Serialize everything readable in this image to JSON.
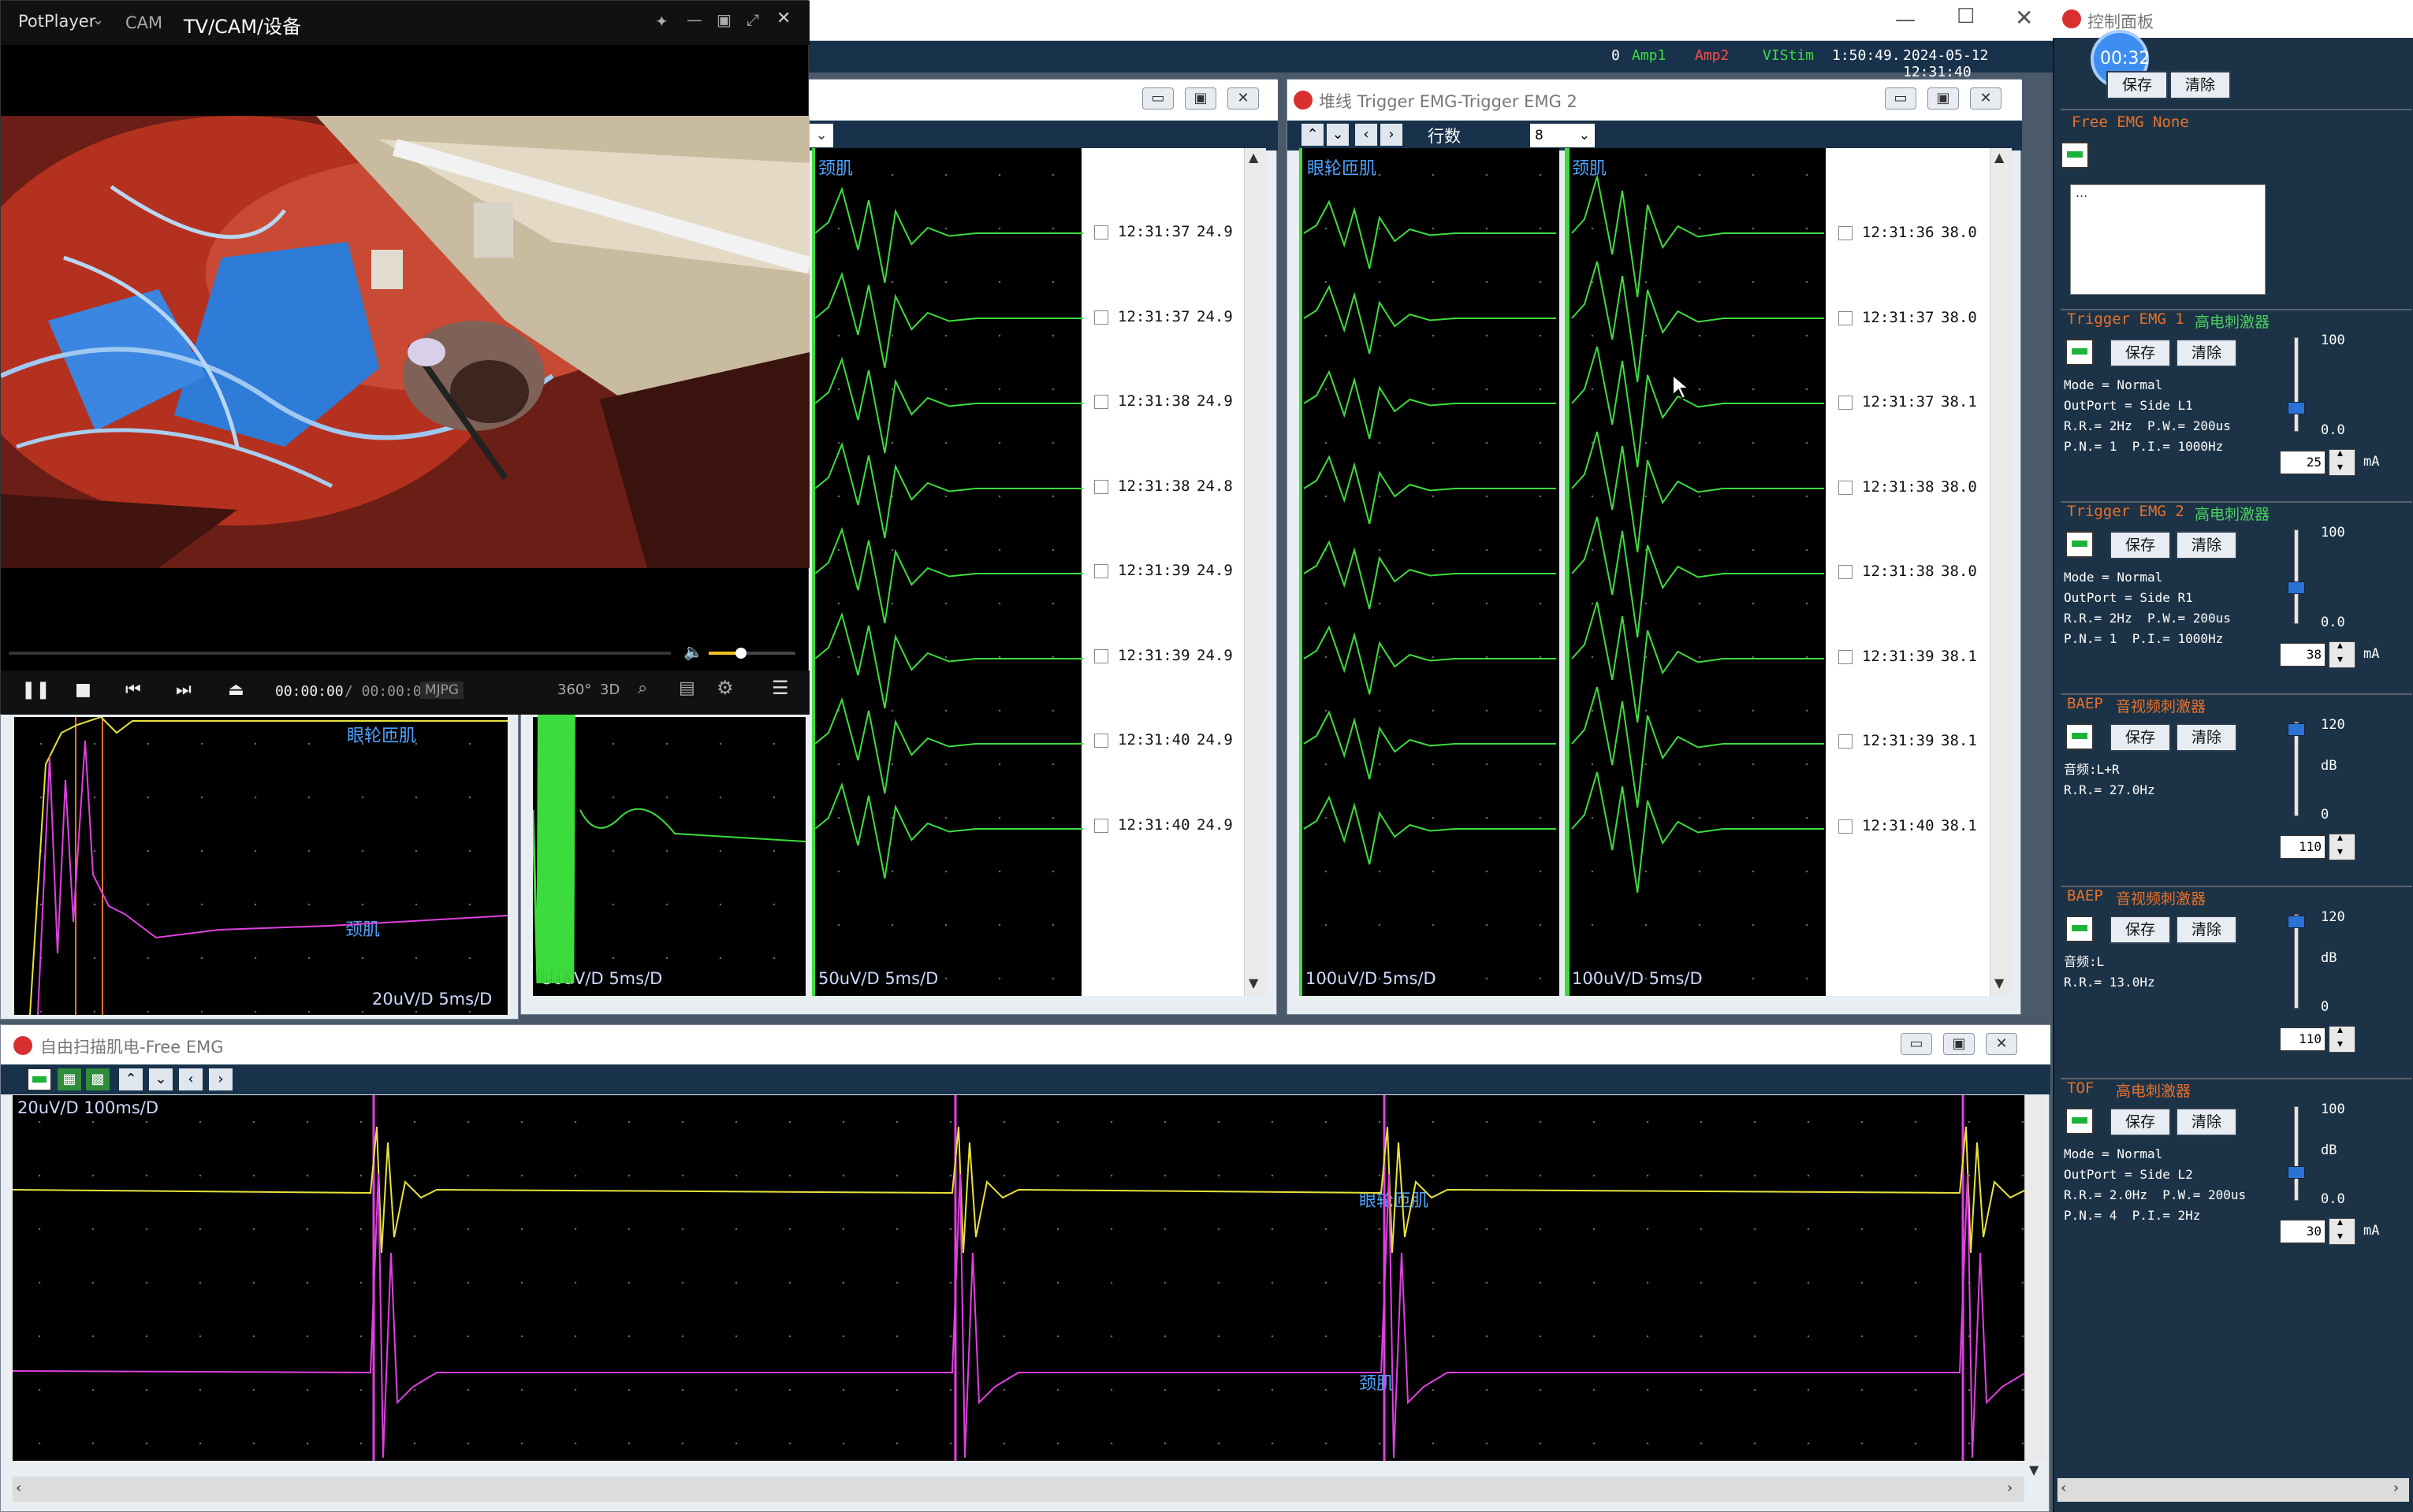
{
  "potplayer": {
    "app_name": "PotPlayer",
    "cam_label": "CAM",
    "source_title": "TV/CAM/设备",
    "time_current": "00:00:00",
    "time_total": "/ 00:00:00",
    "codec": "MJPG",
    "btn_360": "360°",
    "btn_3d": "3D"
  },
  "status_bar": {
    "zero": "0",
    "amp1": "Amp1",
    "amp2": "Amp2",
    "vistim": "VIStim",
    "elapsed": "1:50:49.",
    "datetime": "2024-05-12 12:31:40"
  },
  "window_left": {
    "label_top": "颈肌",
    "scale_a": "50uV/D 5ms/D",
    "scale_b": "50uV/D 5ms/D",
    "rows": [
      {
        "time": "12:31:37",
        "value": "24.9"
      },
      {
        "time": "12:31:37",
        "value": "24.9"
      },
      {
        "time": "12:31:38",
        "value": "24.9"
      },
      {
        "time": "12:31:38",
        "value": "24.8"
      },
      {
        "time": "12:31:39",
        "value": "24.9"
      },
      {
        "time": "12:31:39",
        "value": "24.9"
      },
      {
        "time": "12:31:40",
        "value": "24.9"
      },
      {
        "time": "12:31:40",
        "value": "24.9"
      }
    ]
  },
  "window_trigger": {
    "title": "堆线 Trigger EMG-Trigger EMG 2",
    "rows_label": "行数",
    "rows_value": "8",
    "label_left": "眼轮匝肌",
    "label_right": "颈肌",
    "scale_left": "100uV/D 5ms/D",
    "scale_right": "100uV/D 5ms/D",
    "rows": [
      {
        "time": "12:31:36",
        "value": "38.0"
      },
      {
        "time": "12:31:37",
        "value": "38.0"
      },
      {
        "time": "12:31:37",
        "value": "38.1"
      },
      {
        "time": "12:31:38",
        "value": "38.0"
      },
      {
        "time": "12:31:38",
        "value": "38.0"
      },
      {
        "time": "12:31:39",
        "value": "38.1"
      },
      {
        "time": "12:31:39",
        "value": "38.1"
      },
      {
        "time": "12:31:40",
        "value": "38.1"
      }
    ]
  },
  "window_small": {
    "label_top": "眼轮匝肌",
    "label_bottom": "颈肌",
    "scale": "20uV/D  5ms/D"
  },
  "window_free": {
    "title": "自由扫描肌电-Free EMG",
    "scale": "20uV/D  100ms/D",
    "label_a": "眼轮匝肌",
    "label_b": "颈肌"
  },
  "control_panel": {
    "title": "控制面板",
    "timer": "00:32",
    "save": "保存",
    "clear": "清除",
    "free_emg_title": "Free EMG  None",
    "free_emg_box": "...",
    "unit_ma": "mA",
    "unit_db": "dB",
    "sections": [
      {
        "title_a": "Trigger EMG 1",
        "title_b": "高电刺激器",
        "info": "Mode = Normal\nOutPort = Side L1\nR.R.= 2Hz  P.W.= 200us\nP.N.= 1  P.I.= 1000Hz",
        "max": "100",
        "min": "0.0",
        "value": "25",
        "level": 0.25
      },
      {
        "title_a": "Trigger EMG 2",
        "title_b": "高电刺激器",
        "info": "Mode = Normal\nOutPort = Side R1\nR.R.= 2Hz  P.W.= 200us\nP.N.= 1  P.I.= 1000Hz",
        "max": "100",
        "min": "0.0",
        "value": "38",
        "level": 0.38
      },
      {
        "title_a": "BAEP",
        "title_b": "音视频刺激器",
        "info": "音频:L+R\nR.R.= 27.0Hz",
        "max": "120",
        "min": "0",
        "value": "110",
        "level": 0.92
      },
      {
        "title_a": "BAEP",
        "title_b": "音视频刺激器",
        "info": "音频:L\nR.R.= 13.0Hz",
        "max": "120",
        "min": "0",
        "value": "110",
        "level": 0.92
      },
      {
        "title_a": "TOF",
        "title_b": "高电刺激器",
        "info": "Mode = Normal\nOutPort = Side L2\nR.R.= 2.0Hz  P.W.= 200us\nP.N.= 4  P.I.= 2Hz",
        "max": "100",
        "min": "0.0",
        "value": "30",
        "level": 0.3
      }
    ]
  },
  "colors": {
    "trace_green": "#3ddc3d",
    "trace_yellow": "#e8e23a",
    "trace_magenta": "#e040e0",
    "panel_bg": "#1c3347",
    "section_title_orange": "#e8702a",
    "section_title_green": "#4cd060"
  }
}
